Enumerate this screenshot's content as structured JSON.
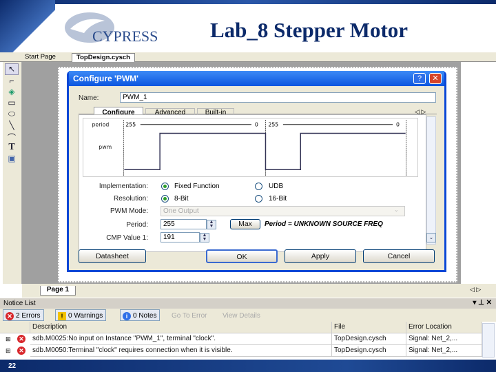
{
  "slide": {
    "title": "Lab_8 Stepper Motor",
    "page_number": "22",
    "logo_text": "CYPRESS"
  },
  "doc_tabs": [
    {
      "label": "Start Page"
    },
    {
      "label": "TopDesign.cysch"
    }
  ],
  "tools": [
    "pointer-icon",
    "wire-icon",
    "component-icon",
    "rectangle-icon",
    "ellipse-icon",
    "line-icon",
    "arc-icon",
    "text-icon",
    "image-icon"
  ],
  "dialog": {
    "title": "Configure 'PWM'",
    "name_label": "Name:",
    "name_value": "PWM_1",
    "tabs": [
      {
        "label": "Configure"
      },
      {
        "label": "Advanced"
      },
      {
        "label": "Built-in"
      }
    ],
    "waveform": {
      "period_label": "period",
      "pwm_label": "pwm",
      "period_start": "255",
      "period_end": "0"
    },
    "implementation": {
      "label": "Implementation:",
      "options": [
        "Fixed Function",
        "UDB"
      ],
      "selected": "Fixed Function"
    },
    "resolution": {
      "label": "Resolution:",
      "options": [
        "8-Bit",
        "16-Bit"
      ],
      "selected": "8-Bit"
    },
    "pwm_mode": {
      "label": "PWM Mode:",
      "value": "One Output"
    },
    "period": {
      "label": "Period:",
      "value": "255",
      "max_label": "Max",
      "note": "Period = UNKNOWN SOURCE FREQ"
    },
    "cmp": {
      "label": "CMP Value 1:",
      "value": "191"
    },
    "buttons": {
      "datasheet": "Datasheet",
      "ok": "OK",
      "apply": "Apply",
      "cancel": "Cancel"
    }
  },
  "page_tab": "Page 1",
  "notice_list": {
    "title": "Notice List",
    "errors": "2 Errors",
    "warnings": "0 Warnings",
    "notes": "0 Notes",
    "go_to_error": "Go To Error",
    "view_details": "View Details",
    "columns": [
      "Description",
      "File",
      "Error Location"
    ],
    "rows": [
      {
        "description": "sdb.M0025:No input on Instance \"PWM_1\", terminal \"clock\".",
        "file": "TopDesign.cysch",
        "location": "Signal:  Net_2,..."
      },
      {
        "description": "sdb.M0050:Terminal \"clock\" requires connection when it is visible.",
        "file": "TopDesign.cysch",
        "location": "Signal:  Net_2,..."
      }
    ]
  },
  "colors": {
    "brand_navy": "#0c2a6a",
    "titlebar": "#0a55e0",
    "error": "#d8262b"
  }
}
